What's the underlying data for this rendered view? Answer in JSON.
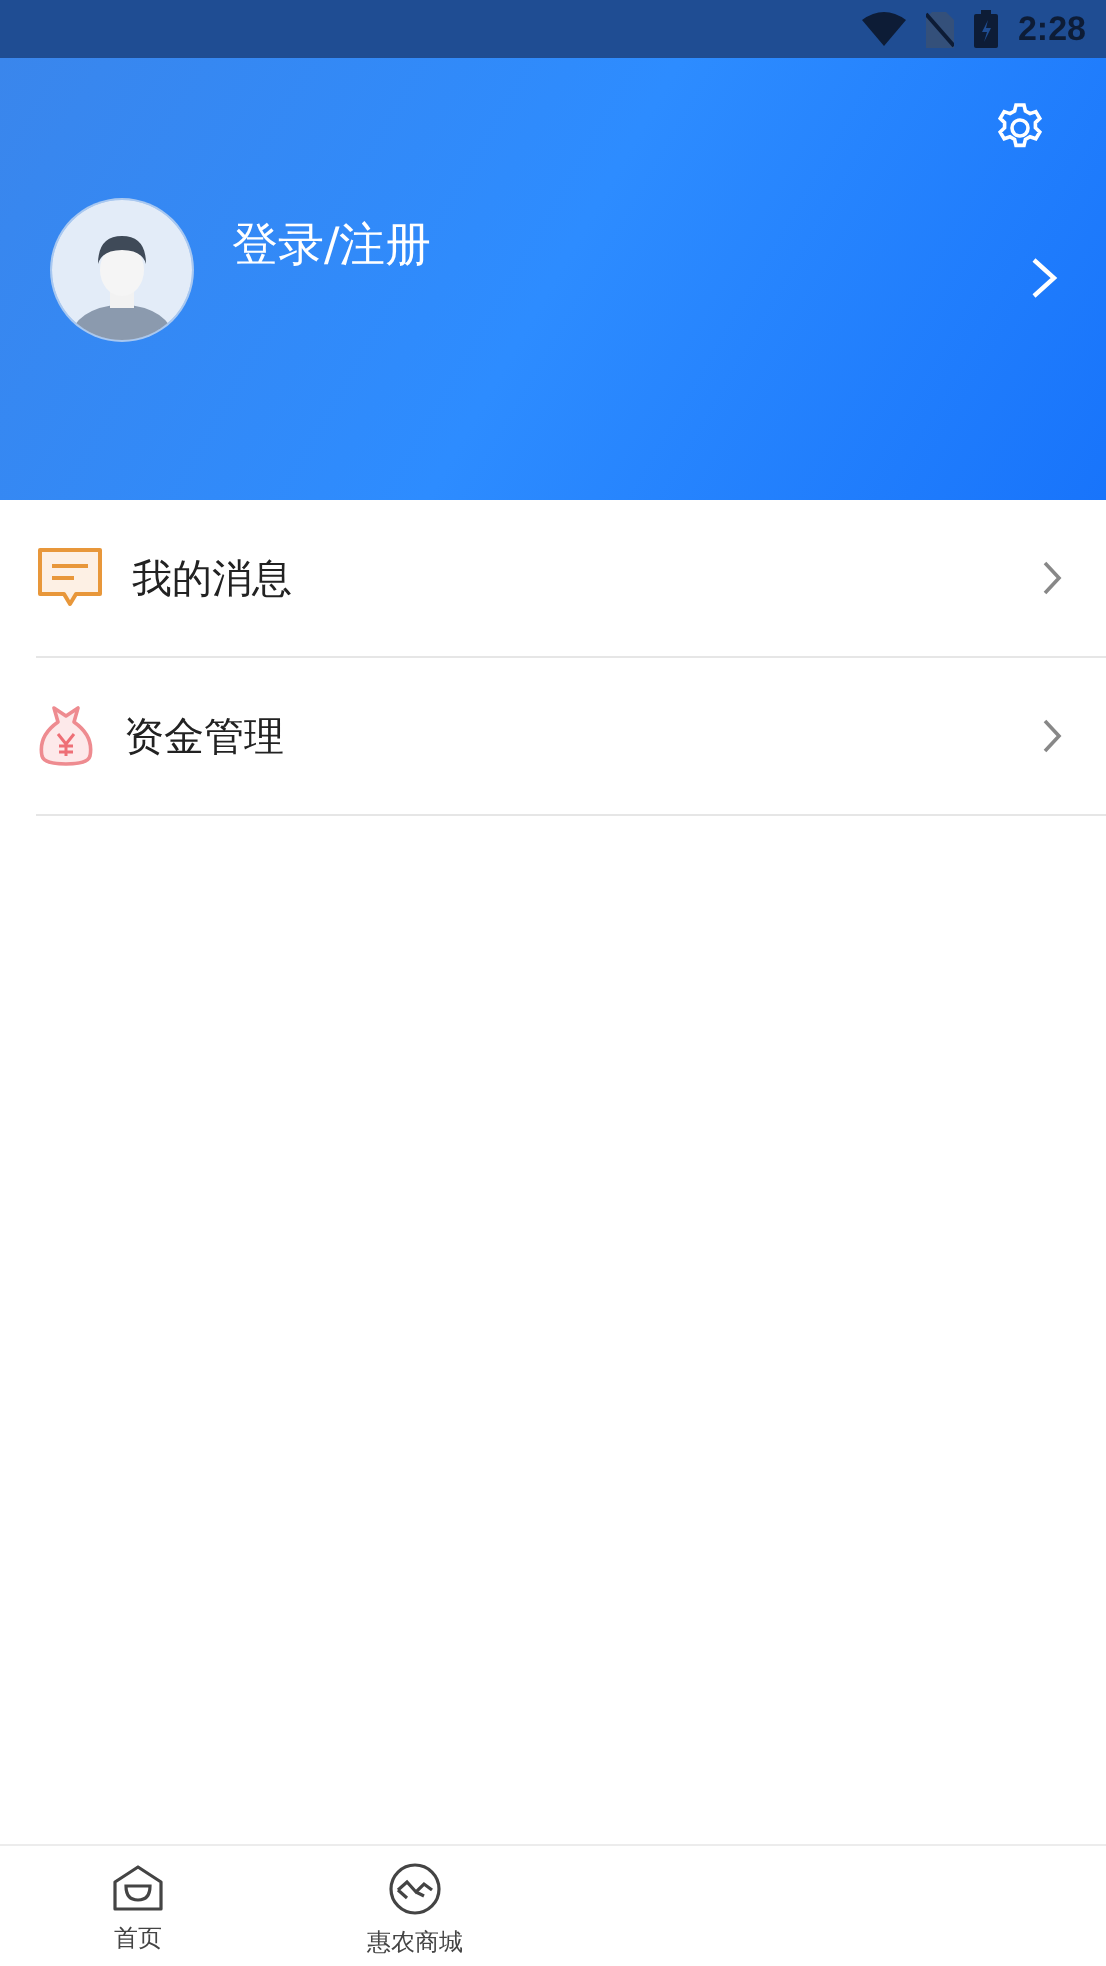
{
  "status_bar": {
    "time": "2:28"
  },
  "profile": {
    "login_label": "登录/注册"
  },
  "menu": [
    {
      "label": "我的消息",
      "kind": "message"
    },
    {
      "label": "资金管理",
      "kind": "money"
    }
  ],
  "bottom_nav": [
    {
      "label": "首页",
      "kind": "home",
      "selected": false
    },
    {
      "label": "惠农商城",
      "kind": "mall",
      "selected": false
    }
  ]
}
